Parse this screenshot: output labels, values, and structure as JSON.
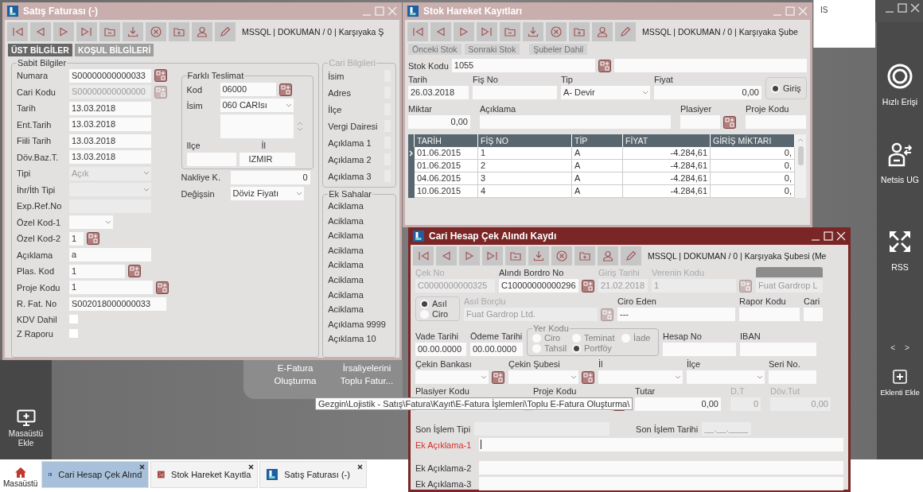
{
  "satis": {
    "title": "Satış Faturası (-)",
    "toolbar_text": "MSSQL | DOKUMAN / 0 | Karşıyaka Ş",
    "tabs": [
      {
        "label": "ÜST BİLGİLER",
        "selected": true
      },
      {
        "label": "KOŞUL BİLGİLERİ",
        "selected": false
      }
    ],
    "sabit_bilgiler": {
      "title": "Sabit Bilgiler",
      "fields": [
        {
          "label": "Numara",
          "value": "S00000000000033",
          "kind": "text",
          "disabled": false,
          "lookup": true
        },
        {
          "label": "Cari Kodu",
          "value": "S00000000000000",
          "kind": "text",
          "disabled": true,
          "lookup": true
        },
        {
          "label": "Tarih",
          "value": "13.03.2018",
          "kind": "text",
          "disabled": false,
          "lookup": false
        },
        {
          "label": "Ent.Tarih",
          "value": "13.03.2018",
          "kind": "text",
          "disabled": false,
          "lookup": false
        },
        {
          "label": "Fiili Tarih",
          "value": "13.03.2018",
          "kind": "text",
          "disabled": false,
          "lookup": false
        },
        {
          "label": "Döv.Baz.T.",
          "value": "13.03.2018",
          "kind": "text",
          "disabled": false,
          "lookup": false
        },
        {
          "label": "Tipi",
          "value": "Açık",
          "kind": "combo",
          "disabled": true,
          "lookup": false
        },
        {
          "label": "İhr/İth Tipi",
          "kind": "combo",
          "disabled": true,
          "lookup": false
        },
        {
          "label": "Exp.Ref.No",
          "kind": "text",
          "disabled": true,
          "lookup": false
        },
        {
          "label": "Özel Kod-1",
          "kind": "combo",
          "disabled": false,
          "lookup": false
        },
        {
          "label": "Özel Kod-2",
          "value": "1",
          "kind": "text",
          "disabled": false,
          "lookup": true
        },
        {
          "label": "Açıklama",
          "value": "a",
          "kind": "text",
          "disabled": false,
          "lookup": false
        },
        {
          "label": "Plas. Kod",
          "value": "1",
          "kind": "text",
          "disabled": false,
          "lookup": true
        },
        {
          "label": "Proje Kodu",
          "value": "1",
          "kind": "text",
          "disabled": false,
          "lookup": true
        },
        {
          "label": "R. Fat. No",
          "value": "S002018000000033",
          "kind": "text",
          "disabled": false,
          "lookup": false
        }
      ],
      "checkboxes": [
        {
          "label": "KDV Dahil",
          "checked": false
        },
        {
          "label": "Z Raporu",
          "checked": false
        }
      ]
    },
    "farkli_teslimat": {
      "title": "Farklı Teslimat",
      "kod_label": "Kod",
      "kod_value": "06000",
      "isim_label": "İsim",
      "isim_value": "060 CARIsı",
      "ilce_label": "Ilçe",
      "il_label": "İl",
      "il_value": "IZMIR"
    },
    "nakliye": {
      "label": "Nakliye K.",
      "value": "0"
    },
    "degissin": {
      "label": "Değişsin",
      "value": "Döviz Fiyatı"
    },
    "cari_bilgileri": {
      "title": "Cari Bilgileri",
      "labels": [
        "İsim",
        "Adres",
        "İlçe",
        "Vergi Dairesi",
        "Açıklama 1",
        "Açıklama 2",
        "Açıklama 3"
      ]
    },
    "ek_sahalar": {
      "title": "Ek Sahalar",
      "labels": [
        "Aciklama",
        "Aciklama",
        "Aciklama",
        "Aciklama",
        "Aciklama",
        "Aciklama",
        "Aciklama",
        "Aciklama",
        "Açıklama 9999",
        "Açıklama 10"
      ]
    }
  },
  "stok": {
    "title": "Stok Hareket Kayıtları",
    "toolbar_text": "MSSQL | DOKUMAN / 0 | Karşıyaka Şube",
    "nav_buttons": [
      {
        "label": "Önceki Stok",
        "disabled": true
      },
      {
        "label": "Sonraki Stok",
        "disabled": true
      },
      {
        "label": "Şubeler Dahil",
        "disabled": true
      }
    ],
    "stok_kodu": {
      "label": "Stok Kodu",
      "value": "1055"
    },
    "row1": [
      {
        "label": "Tarih",
        "value": "26.03.2018",
        "kind": "text"
      },
      {
        "label": "Fiş No",
        "kind": "text"
      },
      {
        "label": "Tip",
        "value": "A- Devir",
        "kind": "combo"
      },
      {
        "label": "Fiyat",
        "value": "0,00",
        "kind": "number"
      }
    ],
    "direction": {
      "label": "Giriş",
      "selected": true
    },
    "row2": [
      {
        "label": "Miktar",
        "value": "0,00",
        "kind": "number"
      },
      {
        "label": "Açıklama",
        "kind": "text"
      },
      {
        "label": "Plasiyer",
        "kind": "lookup"
      },
      {
        "label": "Proje Kodu",
        "kind": "text"
      }
    ],
    "table": {
      "columns": [
        "TARİH",
        "FİŞ NO",
        "TİP",
        "FİYAT",
        "GİRİŞ MİKTARI"
      ],
      "rows": [
        {
          "cells": [
            "01.06.2015",
            "1",
            "A",
            "-4.284,61",
            "0,"
          ],
          "selected": true
        },
        {
          "cells": [
            "01.06.2015",
            "2",
            "A",
            "-4.284,61",
            "0,"
          ],
          "selected": false
        },
        {
          "cells": [
            "04.06.2015",
            "3",
            "A",
            "-4.284,61",
            "0,"
          ],
          "selected": false
        },
        {
          "cells": [
            "10.06.2015",
            "4",
            "A",
            "-4.284,61",
            "0,"
          ],
          "selected": false
        }
      ]
    }
  },
  "cari": {
    "title": "Cari Hesap Çek Alındı Kaydı",
    "toolbar_text": "MSSQL | DOKUMAN / 0 | Karşıyaka Şubesi (Me",
    "row1": [
      {
        "label": "Çek No",
        "value": "C0000000000325",
        "kind": "text",
        "disabled": true
      },
      {
        "label": "Alındı Bordro No",
        "value": "C10000000000296",
        "kind": "lookup",
        "disabled": false
      },
      {
        "label": "Giriş Tarihi",
        "value": "21.02.2018",
        "kind": "text",
        "disabled": true
      },
      {
        "label": "Verenin Kodu",
        "value": "1",
        "kind": "lookup",
        "disabled": true
      },
      {
        "value": "Fuat Gardrop L",
        "kind": "text",
        "disabled": true
      }
    ],
    "borclu_type": [
      {
        "label": "Asıl",
        "selected": true
      },
      {
        "label": "Ciro",
        "selected": false
      }
    ],
    "row2": [
      {
        "label": "Asıl Borçlu",
        "value": "Fuat Gardrop Ltd.",
        "kind": "lookup",
        "disabled": true
      },
      {
        "label": "Ciro Eden",
        "value": "---",
        "kind": "text",
        "disabled": false
      },
      {
        "label": "Rapor Kodu",
        "kind": "text",
        "disabled": false
      },
      {
        "label": "Cari",
        "kind": "text",
        "disabled": false
      }
    ],
    "row3": [
      {
        "label": "Vade Tarihi",
        "value": "00.00.0000",
        "kind": "text",
        "disabled": false
      },
      {
        "label": "Ödeme Tarihi",
        "value": "00.00.0000",
        "kind": "text",
        "disabled": false
      }
    ],
    "yer_kodu": {
      "title": "Yer Kodu",
      "disabled": true,
      "options": [
        {
          "label": "Ciro",
          "selected": false
        },
        {
          "label": "Teminat",
          "selected": false
        },
        {
          "label": "İade",
          "selected": false
        },
        {
          "label": "Tahsil",
          "selected": false
        },
        {
          "label": "Portföy",
          "selected": true
        }
      ]
    },
    "row3b": [
      {
        "label": "Hesap No",
        "kind": "text",
        "disabled": false
      },
      {
        "label": "IBAN",
        "kind": "text",
        "disabled": false
      }
    ],
    "row4": [
      {
        "label": "Çekin Bankası",
        "kind": "combo_lookup",
        "disabled": false
      },
      {
        "label": "Çekin Şubesi",
        "kind": "combo_lookup",
        "disabled": false
      },
      {
        "label": "İl",
        "kind": "combo",
        "disabled": false
      },
      {
        "label": "İlçe",
        "kind": "combo",
        "disabled": false
      },
      {
        "label": "Seri No.",
        "kind": "text",
        "disabled": false
      }
    ],
    "row5": [
      {
        "label": "Plasiyer Kodu",
        "kind": "text",
        "disabled": false
      },
      {
        "label": "Proje Kodu",
        "kind": "lookup",
        "disabled": false
      },
      {
        "label": "Tutar",
        "value": "0,00",
        "kind": "number",
        "disabled": false
      },
      {
        "label": "D.T",
        "value": "0",
        "kind": "number",
        "disabled": true
      },
      {
        "label": "Döv.Tut",
        "value": "0,00",
        "kind": "number",
        "disabled": true
      }
    ],
    "son_islem": [
      {
        "label": "Son İşlem Tipi",
        "kind": "text",
        "disabled": true
      },
      {
        "label": "Son İşlem Tarihi",
        "value": "__.__.____",
        "kind": "text",
        "disabled": true
      }
    ],
    "ek_aciklama": [
      {
        "label": "Ek Açıklama-1",
        "focused": true
      },
      {
        "label": "Ek Açıklama-2",
        "focused": false
      },
      {
        "label": "Ek Açıklama-3",
        "focused": false
      }
    ]
  },
  "tooltip": "Gezgin\\Lojistik - Satış\\Fatura\\Kayıt\\E-Fatura İşlemleri\\Toplu E-Fatura Oluşturma\\",
  "desktop": {
    "shortcuts": [
      "E-Fatura Oluşturma",
      "İrsaliyelerini Toplu Fatur..."
    ],
    "add_desktop": "Masaüstü Ekle",
    "corner_text": "IS"
  },
  "sidebar": {
    "items": [
      {
        "label": "Hızlı Erişi",
        "kind": "ring"
      },
      {
        "label": "Netsis UG",
        "kind": "user"
      },
      {
        "label": "RSS",
        "kind": "expand"
      }
    ],
    "pager": [
      "<",
      ">"
    ],
    "add": "Eklenti Ekle"
  },
  "taskbar": {
    "home": "Masaüstü",
    "tabs": [
      {
        "label": "Cari Hesap Çek Alınd",
        "selected": true,
        "kind": "app"
      },
      {
        "label": "Stok Hareket Kayıtla",
        "selected": false,
        "kind": "stock"
      },
      {
        "label": "Satış Faturası (-)",
        "selected": false,
        "kind": "app"
      }
    ]
  }
}
